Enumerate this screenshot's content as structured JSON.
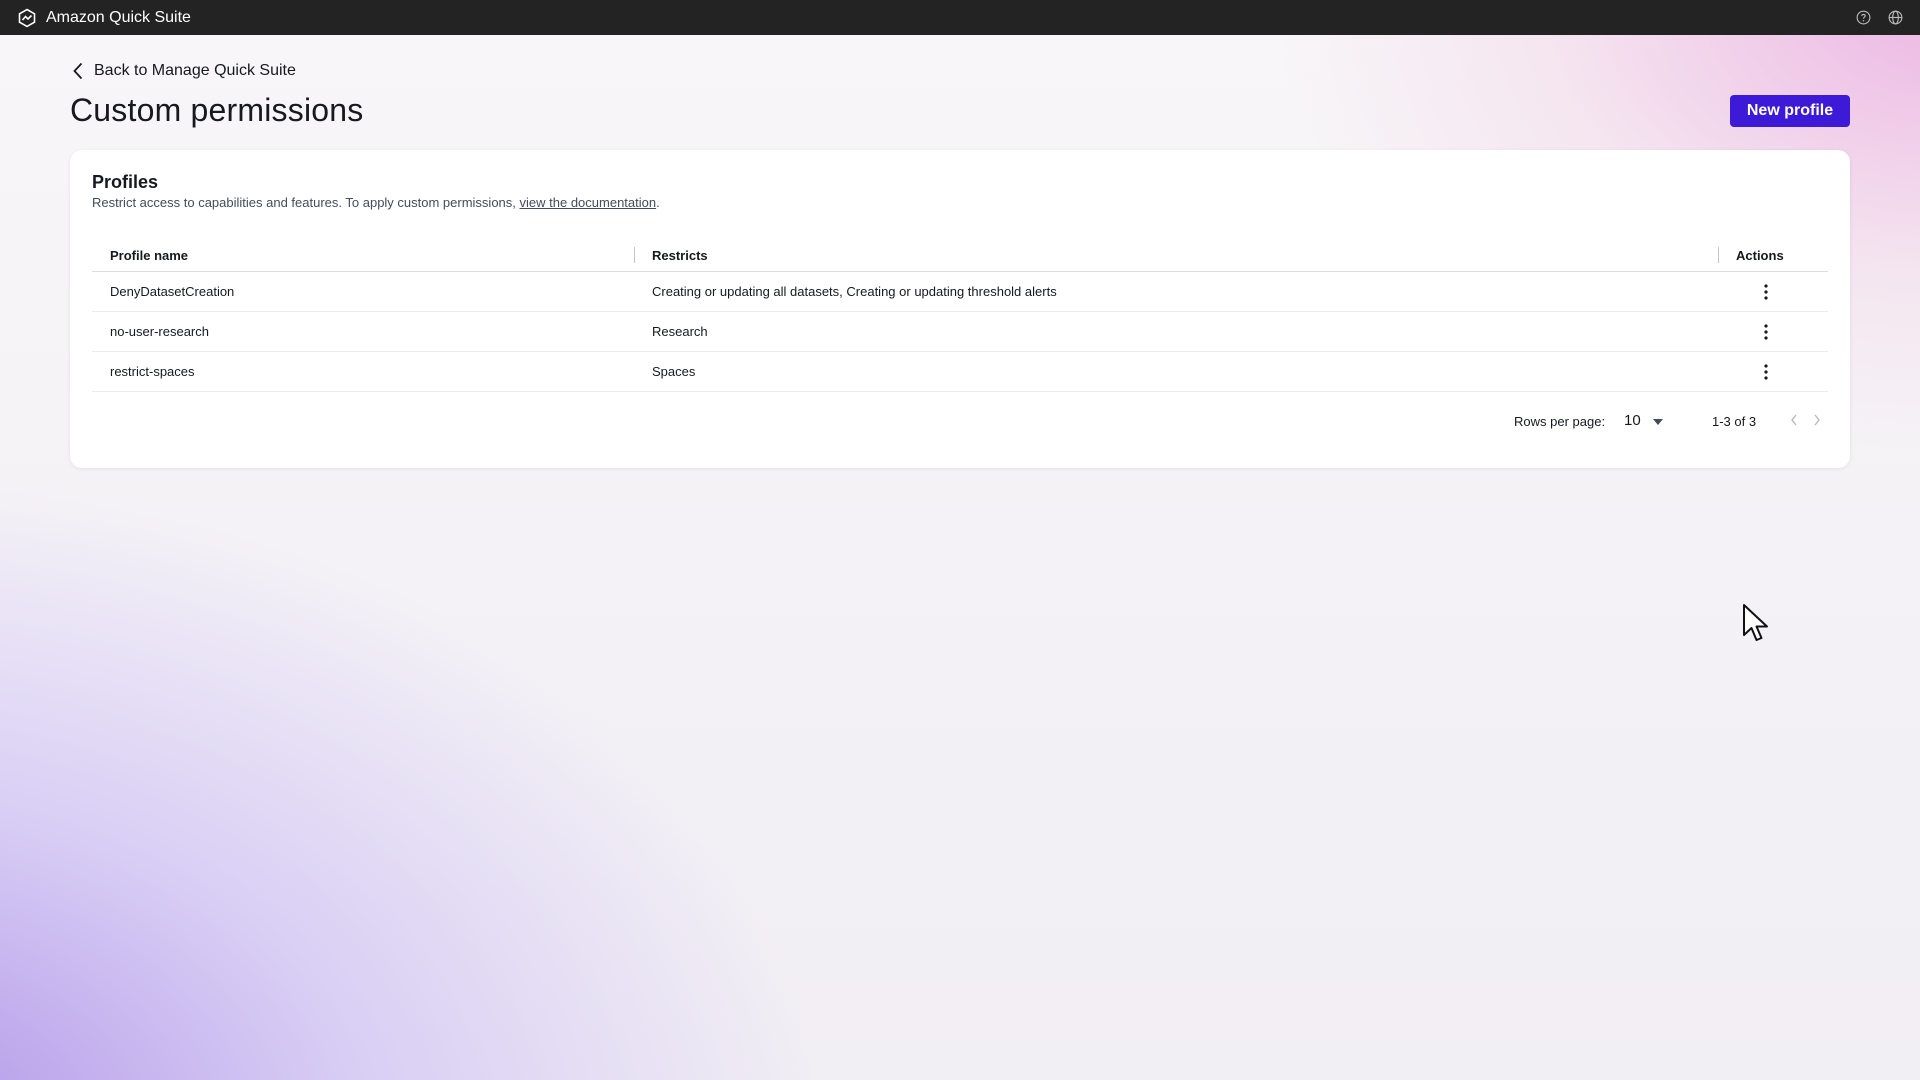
{
  "app": {
    "title": "Amazon Quick Suite",
    "help_icon": "help-circle-icon",
    "language_icon": "globe-icon"
  },
  "nav": {
    "back_label": "Back to Manage Quick Suite"
  },
  "page": {
    "title": "Custom permissions",
    "new_button_label": "New profile"
  },
  "profiles_card": {
    "title": "Profiles",
    "description_prefix": "Restrict access to capabilities and features. To apply custom permissions, ",
    "description_link": "view the documentation",
    "description_suffix": ".",
    "columns": [
      "Profile name",
      "Restricts",
      "Actions"
    ],
    "rows": [
      {
        "name": "DenyDatasetCreation",
        "restricts": "Creating or updating all datasets, Creating or updating threshold alerts"
      },
      {
        "name": "no-user-research",
        "restricts": "Research"
      },
      {
        "name": "restrict-spaces",
        "restricts": "Spaces"
      }
    ],
    "pagination": {
      "rows_per_page_label": "Rows per page:",
      "rows_per_page_value": "10",
      "range": "1-3 of 3"
    }
  },
  "colors": {
    "accent": "#3d1ad8",
    "topbar": "#232323"
  }
}
